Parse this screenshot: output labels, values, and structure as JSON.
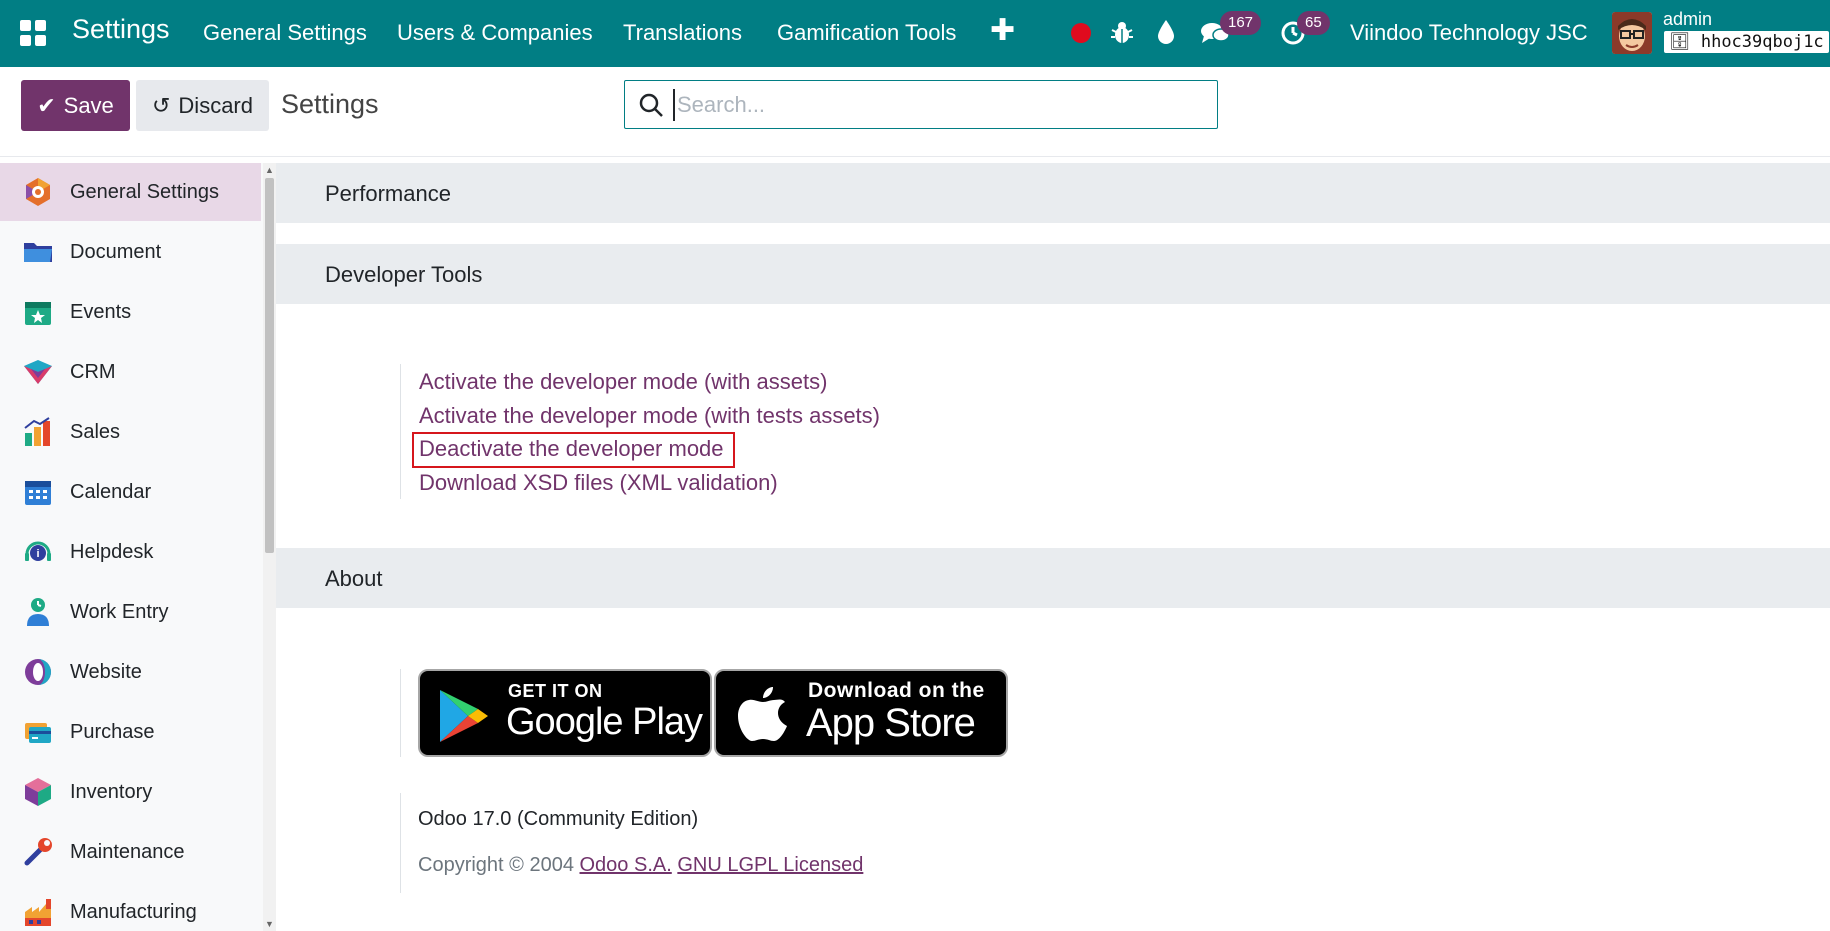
{
  "topbar": {
    "brand": "Settings",
    "menu": [
      "General Settings",
      "Users & Companies",
      "Translations",
      "Gamification Tools"
    ],
    "messages_count": "167",
    "activities_count": "65",
    "company": "Viindoo Technology JSC",
    "user_name": "admin",
    "database": "hhoc39qboj1c",
    "icons": [
      "apps-icon",
      "plus-icon",
      "record-dot-icon",
      "bug-icon",
      "droplet-icon",
      "chat-icon",
      "clock-icon"
    ],
    "accent_color": "#017e84"
  },
  "control": {
    "save_label": "Save",
    "discard_label": "Discard",
    "title": "Settings",
    "search_placeholder": "Search..."
  },
  "sidebar": {
    "items": [
      {
        "label": "General Settings",
        "icon": "general-settings-icon",
        "active": true
      },
      {
        "label": "Document",
        "icon": "folder-icon"
      },
      {
        "label": "Events",
        "icon": "events-icon"
      },
      {
        "label": "CRM",
        "icon": "crm-icon"
      },
      {
        "label": "Sales",
        "icon": "sales-icon"
      },
      {
        "label": "Calendar",
        "icon": "calendar-icon"
      },
      {
        "label": "Helpdesk",
        "icon": "helpdesk-icon"
      },
      {
        "label": "Work Entry",
        "icon": "work-entry-icon"
      },
      {
        "label": "Website",
        "icon": "website-icon"
      },
      {
        "label": "Purchase",
        "icon": "purchase-icon"
      },
      {
        "label": "Inventory",
        "icon": "inventory-icon"
      },
      {
        "label": "Maintenance",
        "icon": "maintenance-icon"
      },
      {
        "label": "Manufacturing",
        "icon": "manufacturing-icon"
      }
    ]
  },
  "main": {
    "performance_title": "Performance",
    "developer_title": "Developer Tools",
    "developer_links": [
      "Activate the developer mode (with assets)",
      "Activate the developer mode (with tests assets)",
      "Deactivate the developer mode",
      "Download XSD files (XML validation)"
    ],
    "about_title": "About",
    "google_play_small": "GET IT ON",
    "google_play_big": "Google Play",
    "app_store_small": "Download on the",
    "app_store_big": "App Store",
    "version": "Odoo 17.0 (Community Edition)",
    "copyright_prefix": "Copyright © 2004",
    "copyright_company": "Odoo S.A.",
    "license": "GNU LGPL Licensed"
  }
}
